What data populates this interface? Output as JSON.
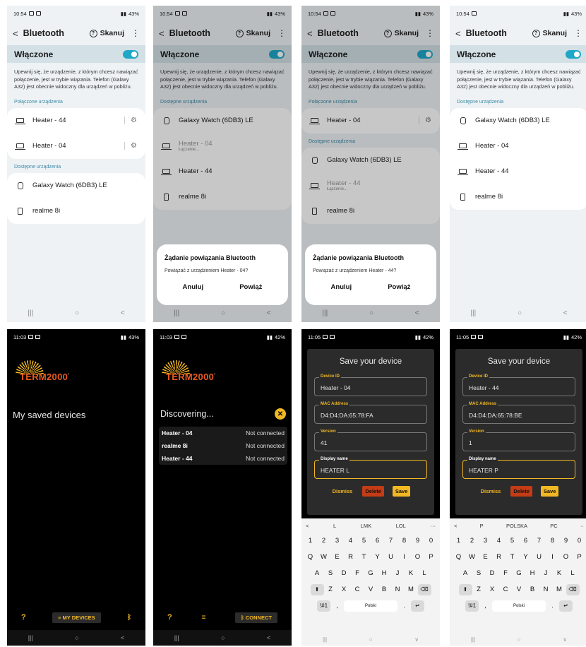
{
  "panel1": {
    "status_time": "10:54",
    "status_battery": "43%",
    "header_title": "Bluetooth",
    "scan_label": "Skanuj",
    "on_label": "Włączone",
    "description": "Upewnij się, że urządzenie, z którym chcesz nawiązać połączenie, jest w trybie wiązania. Telefon (Galaxy A32) jest obecnie widoczny dla urządzeń w pobliżu.",
    "paired_section": "Połączone urządzenia",
    "paired": [
      "Heater - 44",
      "Heater - 04"
    ],
    "available_section": "Dostępne urządzenia",
    "available": [
      "Galaxy Watch (6DB3) LE",
      "realme 8i"
    ]
  },
  "panel2": {
    "status_time": "10:54",
    "status_battery": "43%",
    "header_title": "Bluetooth",
    "scan_label": "Skanuj",
    "on_label": "Włączone",
    "description": "Upewnij się, że urządzenie, z którym chcesz nawiązać połączenie, jest w trybie wiązania. Telefon (Galaxy A32) jest obecnie widoczny dla urządzeń w pobliżu.",
    "available_section": "Dostępne urządzenia",
    "devices": [
      "Galaxy Watch (6DB3) LE",
      "Heater - 04",
      "Heater - 44",
      "realme 8i"
    ],
    "connecting": "Łączenie...",
    "dialog_title": "Żądanie powiązania Bluetooth",
    "dialog_message": "Powiązać z urządzeniem Heater - 04?",
    "cancel": "Anuluj",
    "confirm": "Powiąż"
  },
  "panel3": {
    "status_time": "10:54",
    "status_battery": "43%",
    "header_title": "Bluetooth",
    "scan_label": "Skanuj",
    "on_label": "Włączone",
    "description": "Upewnij się, że urządzenie, z którym chcesz nawiązać połączenie, jest w trybie wiązania. Telefon (Galaxy A32) jest obecnie widoczny dla urządzeń w pobliżu.",
    "paired_section": "Połączone urządzenia",
    "paired": [
      "Heater - 04"
    ],
    "available_section": "Dostępne urządzenia",
    "available": [
      "Galaxy Watch (6DB3) LE",
      "Heater - 44",
      "realme 8i"
    ],
    "connecting": "Łączenie...",
    "dialog_title": "Żądanie powiązania Bluetooth",
    "dialog_message": "Powiązać z urządzeniem Heater - 44?",
    "cancel": "Anuluj",
    "confirm": "Powiąż"
  },
  "panel4": {
    "status_time": "10:54",
    "status_battery": "43%",
    "header_title": "Bluetooth",
    "scan_label": "Skanuj",
    "on_label": "Włączone",
    "description": "Upewnij się, że urządzenie, z którym chcesz nawiązać połączenie, jest w trybie wiązania. Telefon (Galaxy A32) jest obecnie widoczny dla urządzeń w pobliżu.",
    "available_section": "Dostępne urządzenia",
    "devices": [
      "Galaxy Watch (6DB3) LE",
      "Heater - 04",
      "Heater - 44",
      "realme 8i"
    ]
  },
  "panel5": {
    "status_time": "11:03",
    "status_battery": "43%",
    "logo": "TERM2000",
    "title": "My saved devices",
    "help": "?",
    "my_devices": "MY DEVICES"
  },
  "panel6": {
    "status_time": "11:03",
    "status_battery": "42%",
    "logo": "TERM2000",
    "discovering": "Discovering...",
    "devices": [
      {
        "name": "Heater - 04",
        "status": "Not connected"
      },
      {
        "name": "realme 8i",
        "status": "Not connected"
      },
      {
        "name": "Heater - 44",
        "status": "Not connected"
      }
    ],
    "help": "?",
    "connect": "CONNECT"
  },
  "panel7": {
    "status_time": "11:05",
    "status_battery": "42%",
    "modal_title": "Save your device",
    "label_device_id": "Device ID",
    "device_id": "Heater - 04",
    "label_mac": "MAC Address",
    "mac": "D4:D4:DA:65:78:FA",
    "label_version": "Version",
    "version": "41",
    "label_display": "Display name",
    "display_name": "HEATER L",
    "dismiss": "Dismiss",
    "delete": "Delete",
    "save": "Save",
    "suggestions": [
      "L",
      "LMK",
      "LOL"
    ],
    "space_label": "Polski",
    "sym_key": "!#1"
  },
  "panel8": {
    "status_time": "11:05",
    "status_battery": "42%",
    "modal_title": "Save your device",
    "label_device_id": "Device ID",
    "device_id": "Heater - 44",
    "label_mac": "MAC Address",
    "mac": "D4:D4:DA:65:78:BE",
    "label_version": "Version",
    "version": "1",
    "label_display": "Display name",
    "display_name": "HEATER P",
    "dismiss": "Dismiss",
    "delete": "Delete",
    "save": "Save",
    "suggestions": [
      "P",
      "POLSKA",
      "PC"
    ],
    "space_label": "Polski",
    "sym_key": "!#1"
  },
  "keyboard": {
    "row_numbers": [
      "1",
      "2",
      "3",
      "4",
      "5",
      "6",
      "7",
      "8",
      "9",
      "0"
    ],
    "row_q": [
      "Q",
      "W",
      "E",
      "R",
      "T",
      "Y",
      "U",
      "I",
      "O",
      "P"
    ],
    "row_a": [
      "A",
      "S",
      "D",
      "F",
      "G",
      "H",
      "J",
      "K",
      "L"
    ],
    "row_z": [
      "Z",
      "X",
      "C",
      "V",
      "B",
      "N",
      "M"
    ]
  },
  "colors": {
    "accent_yellow": "#f2b824",
    "toggle_blue": "#1fa7c8",
    "delete_red": "#c33c15",
    "logo_orange": "#ea5a1e"
  }
}
